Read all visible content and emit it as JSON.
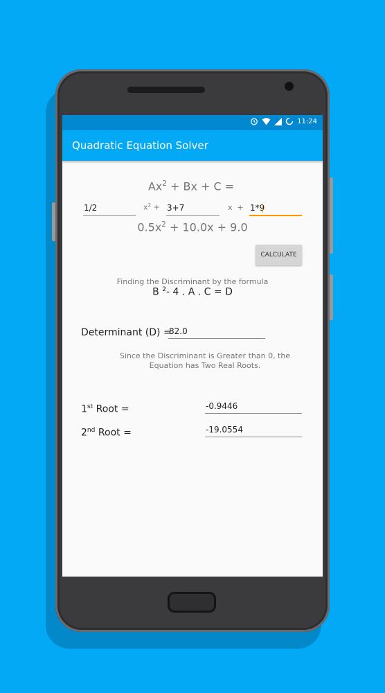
{
  "status_bar": {
    "time": "11:24",
    "icons": [
      "alarm-icon",
      "wifi-icon",
      "signal-icon",
      "sync-icon"
    ]
  },
  "app_bar": {
    "title": "Quadratic Equation Solver"
  },
  "equation": {
    "general_prefix": "Ax",
    "general_exp": "2",
    "general_suffix": " + Bx + C =",
    "a_value": "1/2",
    "x2_label": "x",
    "x2_exp": "2",
    "x2_plus": " +",
    "b_value": "3+7",
    "x_label": "x  +",
    "c_value": "1*9",
    "result_prefix": "0.5x",
    "result_exp": "2",
    "result_suffix": " + 10.0x + 9.0"
  },
  "calculate_button": {
    "label": "CALCULATE"
  },
  "discriminant": {
    "heading": "Finding the Discriminant by the formula",
    "formula_b": "B ",
    "formula_exp": "2",
    "formula_rest": "- 4 . A . C = D",
    "label": "Determinant (D) =",
    "value": "82.0",
    "message": "Since the Discriminant is Greater than 0, the Equation has Two Real Roots."
  },
  "roots": [
    {
      "ordinal": "1",
      "ordinal_sup": "st",
      "label": " Root =",
      "value": "-0.9446"
    },
    {
      "ordinal": "2",
      "ordinal_sup": "nd",
      "label": " Root =",
      "value": "-19.0554"
    }
  ],
  "colors": {
    "background": "#03a9f4",
    "app_bar": "#03a9f4",
    "status_bar": "#0288d1",
    "accent": "#ff9800"
  }
}
